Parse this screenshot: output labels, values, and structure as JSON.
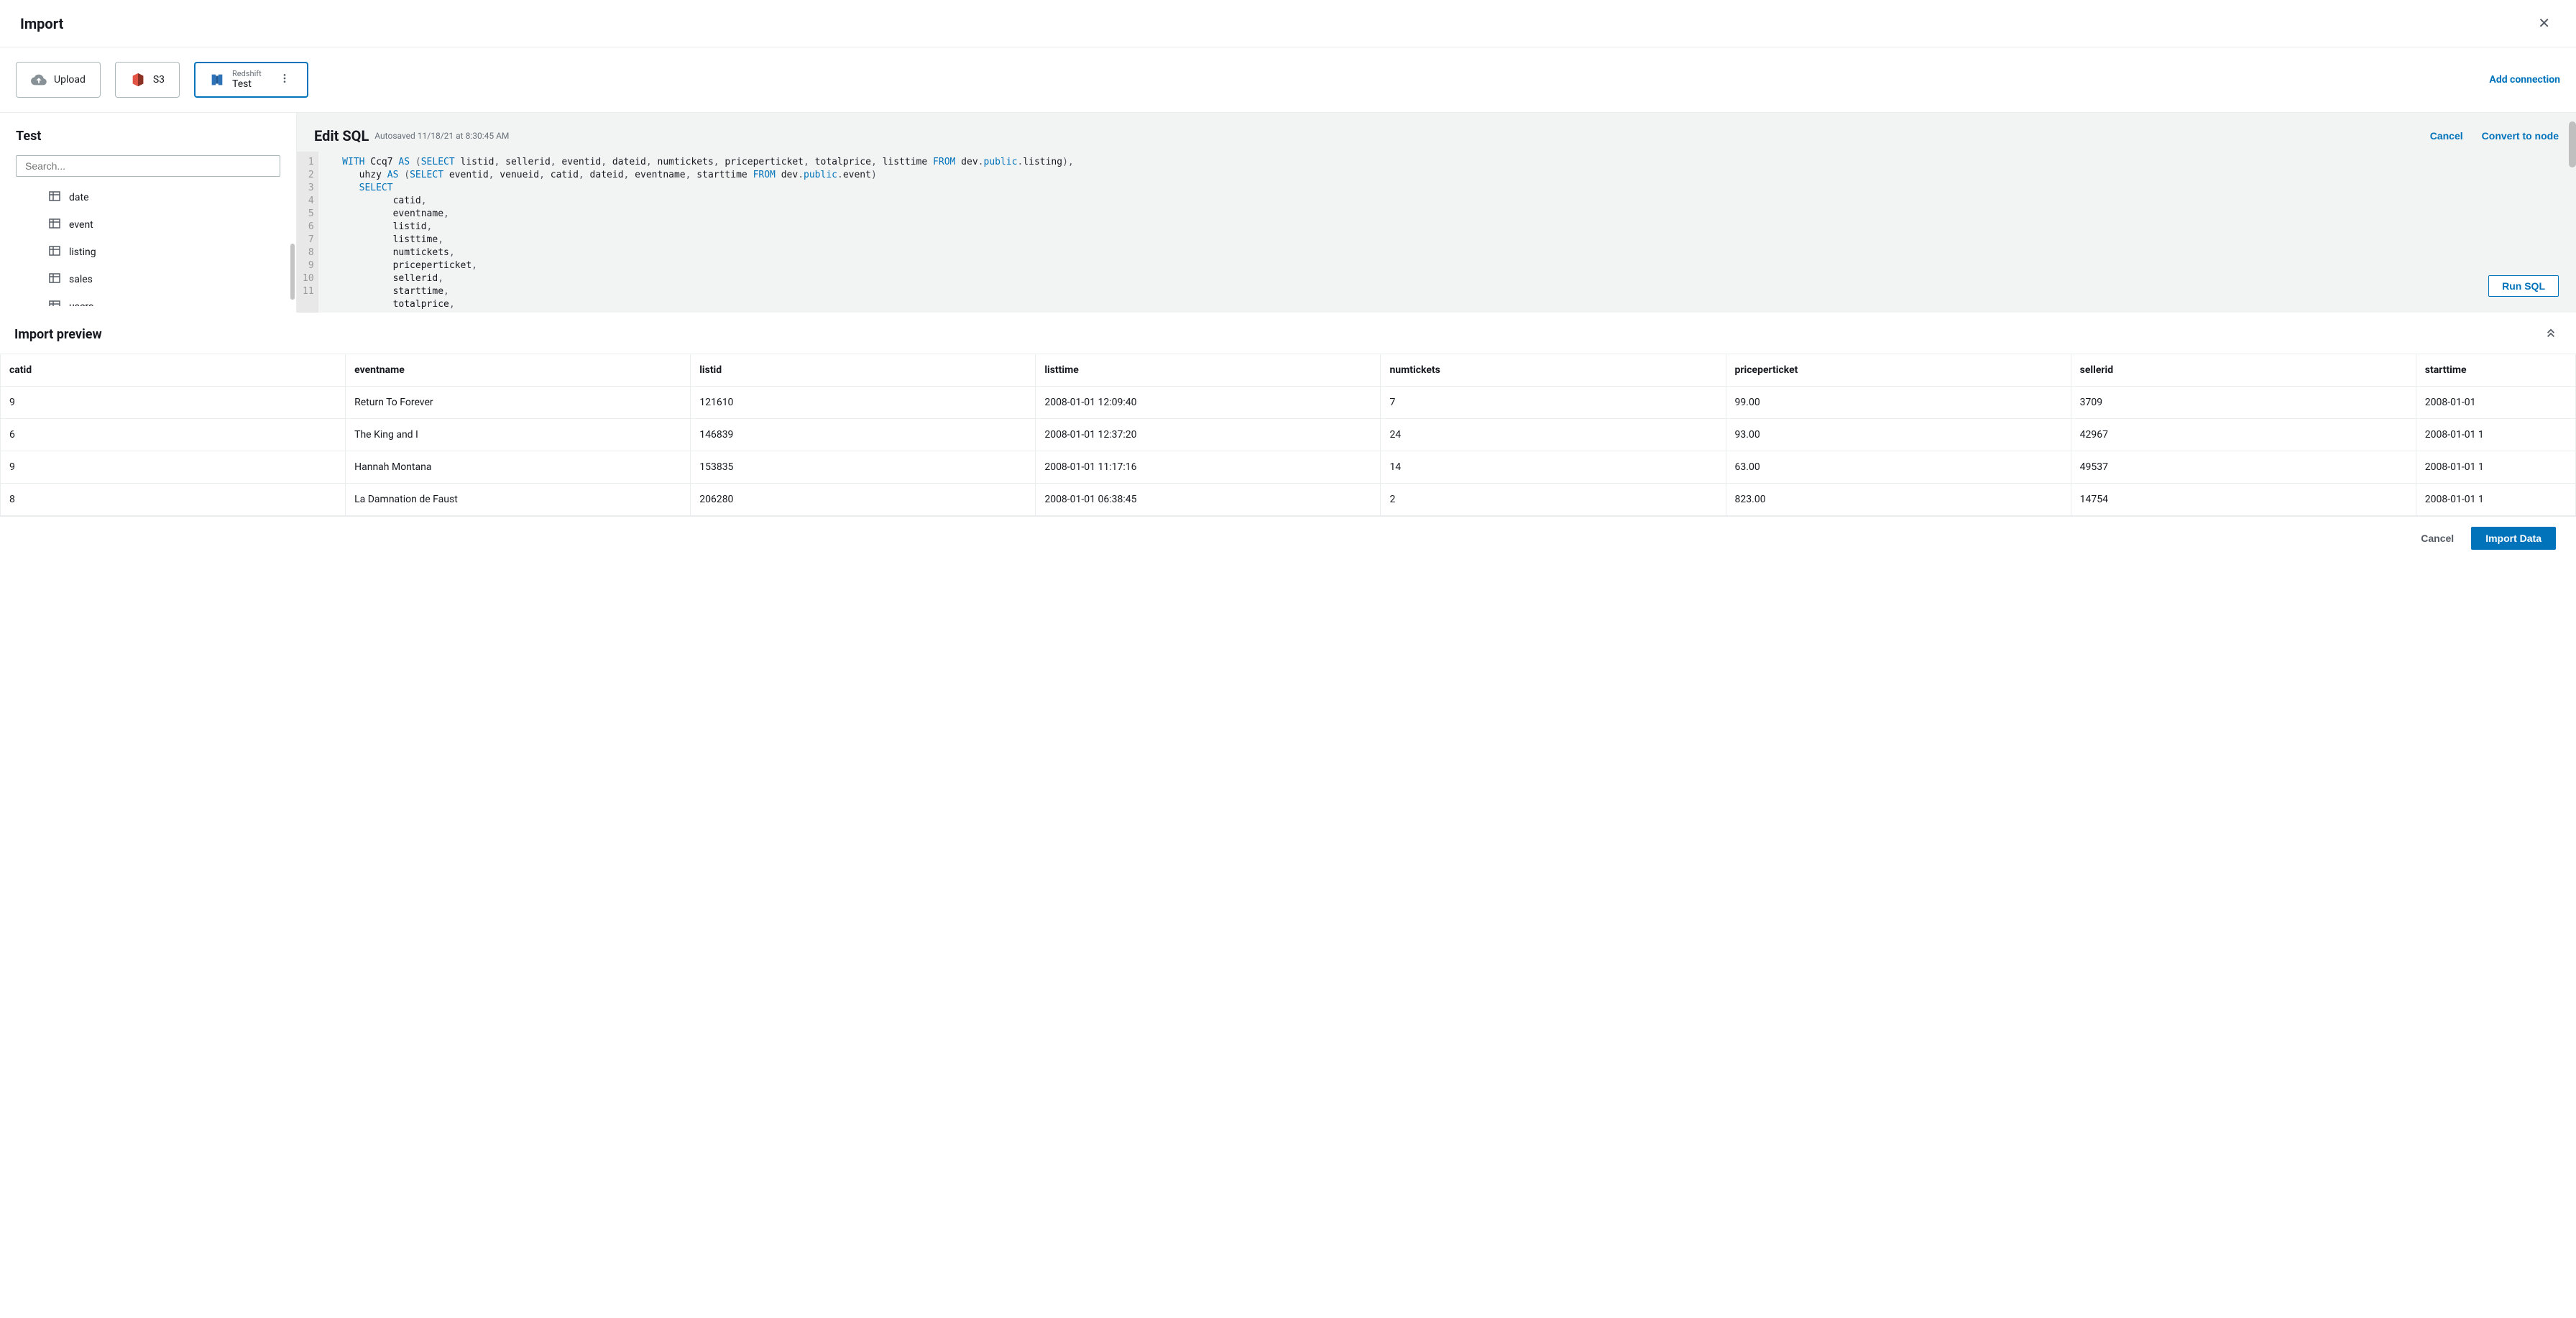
{
  "header": {
    "title": "Import"
  },
  "sources": {
    "upload": "Upload",
    "s3": "S3",
    "redshift_label": "Redshift",
    "redshift_name": "Test",
    "add_connection": "Add connection"
  },
  "left": {
    "title": "Test",
    "search_placeholder": "Search...",
    "tables": [
      "date",
      "event",
      "listing",
      "sales",
      "users"
    ]
  },
  "editor": {
    "title": "Edit SQL",
    "autosave": "Autosaved 11/18/21 at 8:30:45 AM",
    "cancel": "Cancel",
    "convert": "Convert to node",
    "run": "Run SQL",
    "lines": [
      "1",
      "2",
      "3",
      "4",
      "5",
      "6",
      "7",
      "8",
      "9",
      "10",
      "11"
    ]
  },
  "preview": {
    "title": "Import preview",
    "columns": [
      "catid",
      "eventname",
      "listid",
      "listtime",
      "numtickets",
      "priceperticket",
      "sellerid",
      "starttime"
    ],
    "rows": [
      [
        "9",
        "Return To Forever",
        "121610",
        "2008-01-01 12:09:40",
        "7",
        "99.00",
        "3709",
        "2008-01-01"
      ],
      [
        "6",
        "The King and I",
        "146839",
        "2008-01-01 12:37:20",
        "24",
        "93.00",
        "42967",
        "2008-01-01 1"
      ],
      [
        "9",
        "Hannah Montana",
        "153835",
        "2008-01-01 11:17:16",
        "14",
        "63.00",
        "49537",
        "2008-01-01 1"
      ],
      [
        "8",
        "La Damnation de Faust",
        "206280",
        "2008-01-01 06:38:45",
        "2",
        "823.00",
        "14754",
        "2008-01-01 1"
      ]
    ]
  },
  "footer": {
    "cancel": "Cancel",
    "import": "Import Data"
  }
}
